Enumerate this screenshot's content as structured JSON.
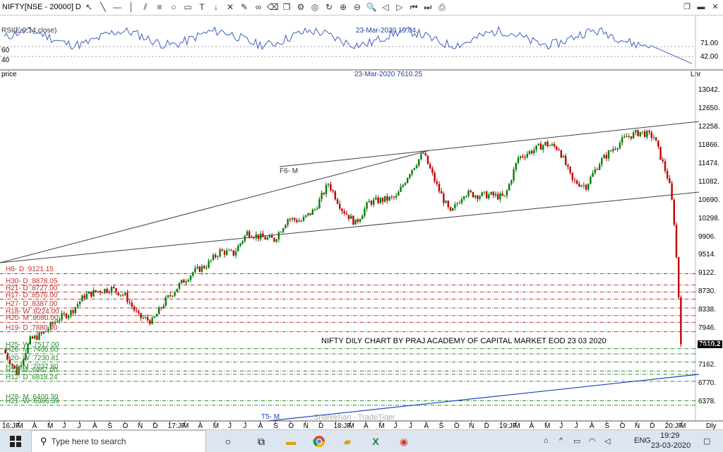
{
  "window": {
    "title": "NIFTY[NSE - 20000] D"
  },
  "rsi": {
    "label": "RSI(E,9,14,close)",
    "cursor_readout": "23-Mar-2020 19.04,",
    "levels": [
      "71.00",
      "42.00"
    ],
    "left_levels": [
      "60",
      "40"
    ],
    "right_label": "Lnr"
  },
  "price_pane": {
    "label": "price",
    "cursor_readout": "23-Mar-2020 7610.25",
    "price_ticks": [
      "13042",
      "12650",
      "12258",
      "11866",
      "11474",
      "11082",
      "10690",
      "10298",
      "9906",
      "9514",
      "9122",
      "8730",
      "8338",
      "7946",
      "7554",
      "7162",
      "6770",
      "6378"
    ],
    "price_tick_labels": [
      "13042.",
      "12650.",
      "12258.",
      "11866.",
      "11474.",
      "11082.",
      "10690.",
      "10298.",
      "9906.",
      "9514.",
      "9122.",
      "8730.",
      "8338.",
      "7946.",
      "7554.",
      "7162.",
      "6770.",
      "6378."
    ],
    "last_price_label": "7610.2",
    "annotation": "NIFTY DILY CHART BY PRAJ ACADEMY OF CAPITAL MARKET EOD 23 03 2020",
    "trendline_label": "F6- M",
    "trendline2_label": "T5- M",
    "watermark": "Sharekhan - TradeTiger",
    "red_levels": [
      {
        "text": "H8- D :9121.15",
        "value": 9121.15
      },
      {
        "text": "H30- D :8878.05",
        "value": 8878.05
      },
      {
        "text": "H21- D :8727.00",
        "value": 8727.0
      },
      {
        "text": "H17- D :8576.00",
        "value": 8576.0
      },
      {
        "text": "H27- D :8387.00",
        "value": 8387.0
      },
      {
        "text": "H18- W :8224.00",
        "value": 8224.0
      },
      {
        "text": "H20- M :8080.00",
        "value": 8080.0
      },
      {
        "text": "H19- D :7880.00",
        "value": 7880.0
      }
    ],
    "green_levels": [
      {
        "text": "H25- W :7517.00",
        "value": 7517.0
      },
      {
        "text": "H26- M :7405.00",
        "value": 7405.0
      },
      {
        "text": "H20- W :7230.81",
        "value": 7230.81
      },
      {
        "text": "H24- M :7037.80",
        "value": 7037.8
      },
      {
        "text": "H11- M :6967.00",
        "value": 6967.0
      },
      {
        "text": "H12- D :6818.24",
        "value": 6818.24
      },
      {
        "text": "H28- M :6400.39",
        "value": 6400.39
      },
      {
        "text": "H21- W :6306.39",
        "value": 6306.39
      }
    ]
  },
  "x_axis": {
    "labels": [
      "16:JF",
      "M",
      "A",
      "M",
      "J",
      "J",
      "A",
      "S",
      "O",
      "N",
      "D",
      "17:JF",
      "M",
      "A",
      "M",
      "J",
      "J",
      "A",
      "S",
      "O",
      "N",
      "D",
      "18:JF",
      "M",
      "A",
      "M",
      "J",
      "J",
      "A",
      "S",
      "O",
      "N",
      "D",
      "19:JF",
      "M",
      "A",
      "M",
      "J",
      "J",
      "A",
      "S",
      "O",
      "N",
      "D",
      "20:JF",
      "M"
    ],
    "right_label": "Dly"
  },
  "chart_data": {
    "type": "candlestick",
    "title": "NIFTY DILY CHART BY PRAJ ACADEMY OF CAPITAL MARKET EOD 23 03 2020",
    "symbol": "NIFTY[NSE - 20000] D",
    "ylim": [
      6300,
      13200
    ],
    "approx_close_path": [
      [
        "2016-01",
        7500
      ],
      [
        "2016-02",
        7000
      ],
      [
        "2016-03",
        7700
      ],
      [
        "2016-04",
        7850
      ],
      [
        "2016-05",
        8150
      ],
      [
        "2016-06",
        8300
      ],
      [
        "2016-07",
        8650
      ],
      [
        "2016-08",
        8750
      ],
      [
        "2016-09",
        8800
      ],
      [
        "2016-10",
        8650
      ],
      [
        "2016-11",
        8200
      ],
      [
        "2016-12",
        8100
      ],
      [
        "2017-01",
        8550
      ],
      [
        "2017-02",
        8880
      ],
      [
        "2017-03",
        9150
      ],
      [
        "2017-04",
        9300
      ],
      [
        "2017-05",
        9600
      ],
      [
        "2017-06",
        9550
      ],
      [
        "2017-07",
        10000
      ],
      [
        "2017-08",
        9900
      ],
      [
        "2017-09",
        9850
      ],
      [
        "2017-10",
        10300
      ],
      [
        "2017-11",
        10250
      ],
      [
        "2017-12",
        10500
      ],
      [
        "2018-01",
        11050
      ],
      [
        "2018-02",
        10500
      ],
      [
        "2018-03",
        10200
      ],
      [
        "2018-04",
        10650
      ],
      [
        "2018-05",
        10700
      ],
      [
        "2018-06",
        10750
      ],
      [
        "2018-07",
        11300
      ],
      [
        "2018-08",
        11700
      ],
      [
        "2018-09",
        11000
      ],
      [
        "2018-10",
        10400
      ],
      [
        "2018-11",
        10850
      ],
      [
        "2018-12",
        10800
      ],
      [
        "2019-01",
        10800
      ],
      [
        "2019-02",
        10750
      ],
      [
        "2019-03",
        11600
      ],
      [
        "2019-04",
        11750
      ],
      [
        "2019-05",
        11900
      ],
      [
        "2019-06",
        11800
      ],
      [
        "2019-07",
        11100
      ],
      [
        "2019-08",
        11000
      ],
      [
        "2019-09",
        11500
      ],
      [
        "2019-10",
        11800
      ],
      [
        "2019-11",
        12050
      ],
      [
        "2019-12",
        12150
      ],
      [
        "2020-01",
        12050
      ],
      [
        "2020-02",
        11200
      ],
      [
        "2020-03",
        7610.25
      ]
    ],
    "rsi": {
      "label": "RSI(E,9,14,close)",
      "last_value": 19.04,
      "levels": [
        71,
        42
      ]
    }
  },
  "taskbar": {
    "search_placeholder": "Type here to search",
    "language": "ENG",
    "time": "19:29",
    "date": "23-03-2020"
  },
  "colors": {
    "candle_up": "#0a7a0a",
    "candle_down": "#c00000",
    "rsi_line": "#3f5fbf",
    "red_level": "#c03030",
    "green_level": "#2e8b2e",
    "trendline": "#404040",
    "blue_trend": "#1f3fbf"
  }
}
